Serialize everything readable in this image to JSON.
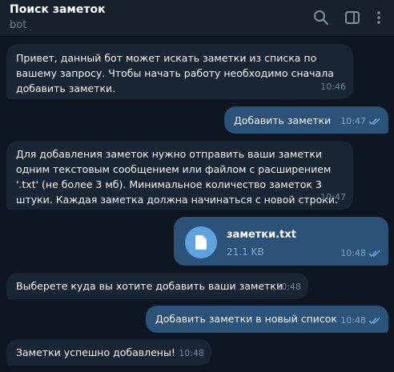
{
  "header": {
    "title": "Поиск заметок",
    "subtitle": "bot"
  },
  "icons": {
    "search": "search-icon",
    "sidebar": "sidebar-toggle-icon",
    "more": "more-vertical-icon"
  },
  "colors": {
    "background": "#0e1621",
    "header": "#17212b",
    "incoming_bubble": "#182533",
    "outgoing_bubble": "#2b5278",
    "accent": "#5fa3de"
  },
  "messages": [
    {
      "direction": "incoming",
      "text": "Привет, данный бот может искать заметки из списка по вашему запросу. Чтобы начать работу необходимо сначала добавить заметки.",
      "time": "10:46"
    },
    {
      "direction": "outgoing",
      "text": "Добавить заметки",
      "time": "10:47",
      "read": true
    },
    {
      "direction": "incoming",
      "text": "Для добавления заметок нужно отправить ваши заметки одним текстовым сообщением или файлом с расширением '.txt' (не более 3 мб). Минимальное количество заметок 3 штуки. Каждая заметка должна начинаться с новой строки.",
      "time": "10:47"
    },
    {
      "direction": "outgoing",
      "type": "file",
      "file_name": "заметки.txt",
      "file_size": "21.1 KB",
      "time": "10:48",
      "read": true
    },
    {
      "direction": "incoming",
      "text": "Выберете куда вы хотите добавить ваши заметки",
      "time": "10:48"
    },
    {
      "direction": "outgoing",
      "text": "Добавить заметки в новый список",
      "time": "10:48",
      "read": true
    },
    {
      "direction": "incoming",
      "text": "Заметки успешно добавлены!",
      "time": "10:48"
    }
  ]
}
